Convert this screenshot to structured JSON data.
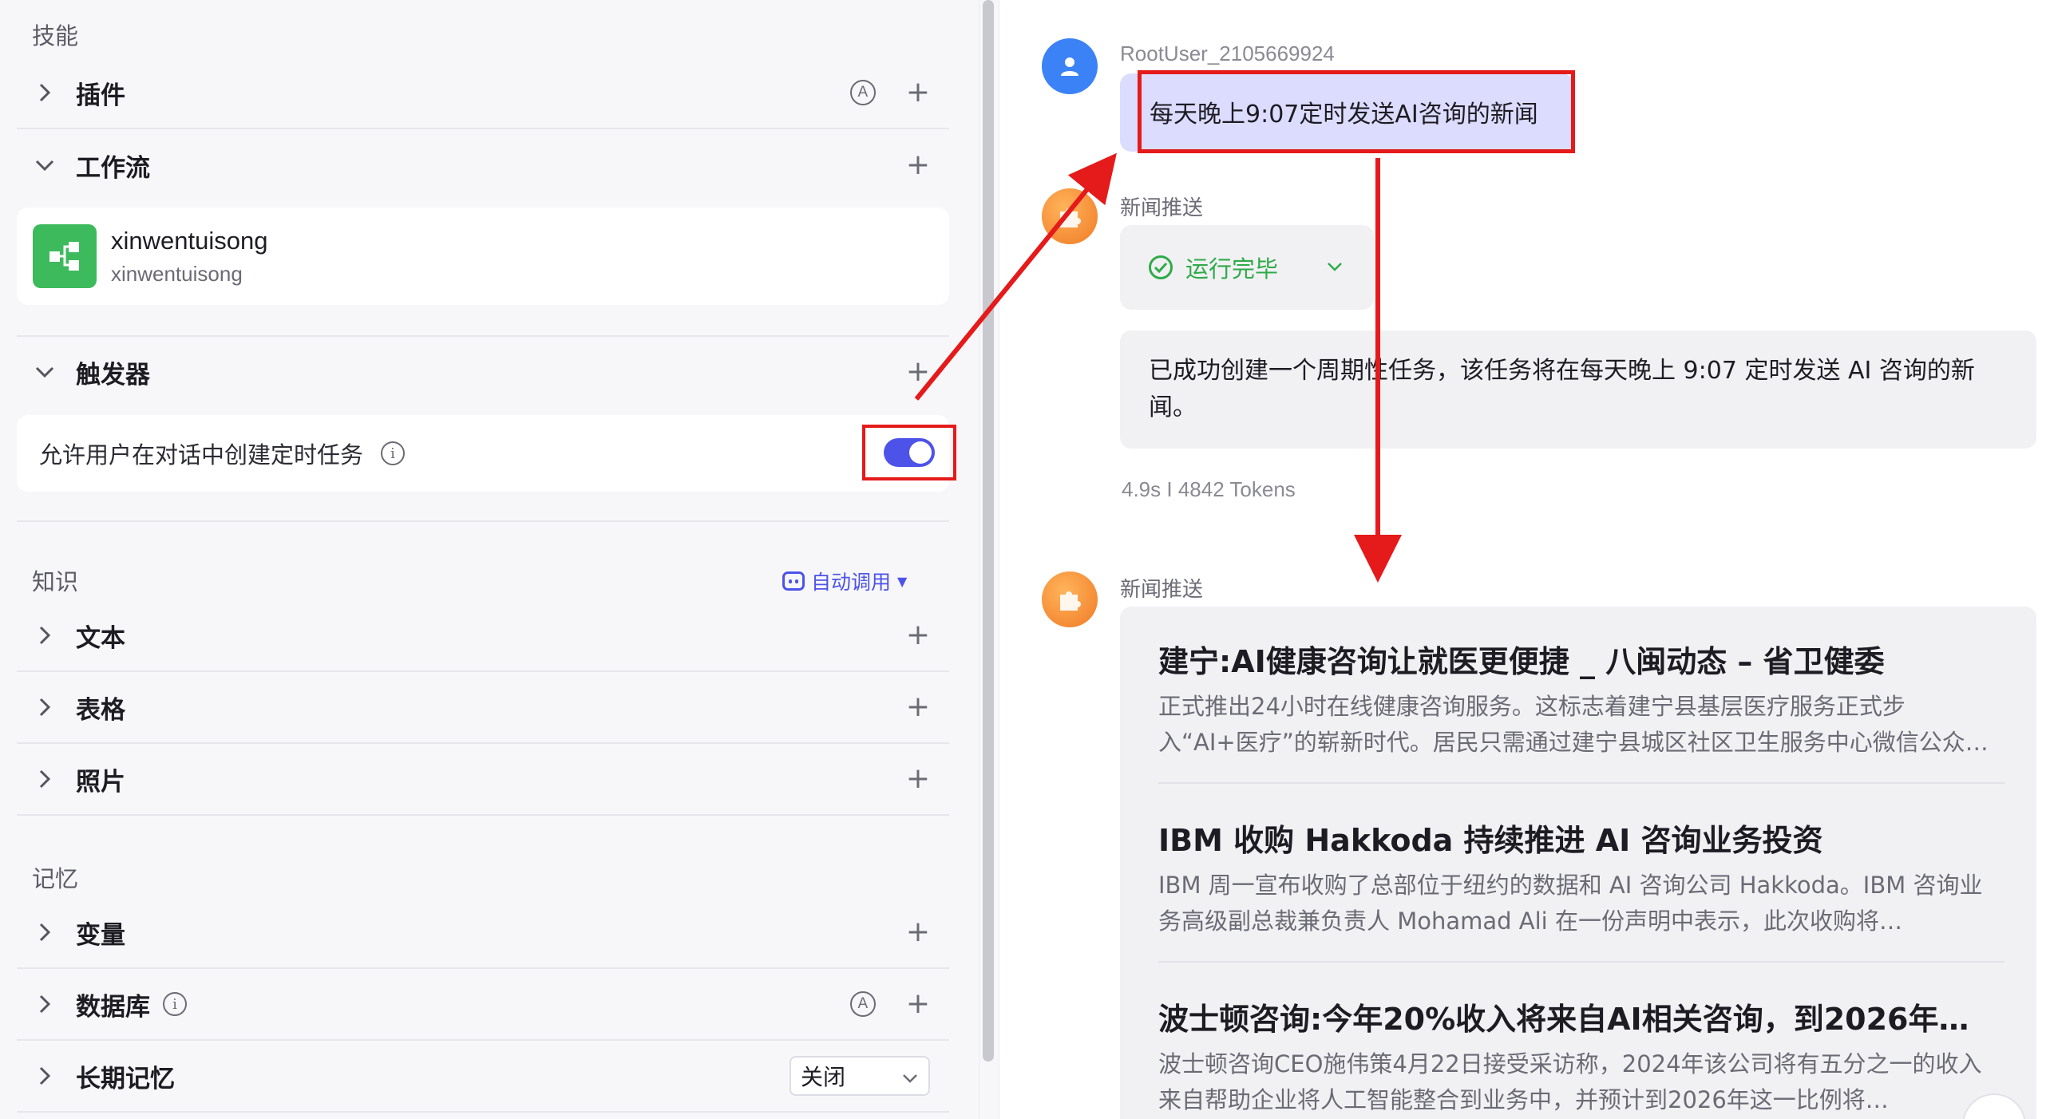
{
  "left": {
    "skills_title": "技能",
    "plugins_label": "插件",
    "workflow_label": "工作流",
    "workflow_item": {
      "name": "xinwentuisong",
      "sub": "xinwentuisong"
    },
    "trigger_label": "触发器",
    "trigger_setting": "允许用户在对话中创建定时任务",
    "toggle_on": true,
    "knowledge_title": "知识",
    "auto_call": "自动调用",
    "text_label": "文本",
    "table_label": "表格",
    "photo_label": "照片",
    "memory_title": "记忆",
    "variable_label": "变量",
    "database_label": "数据库",
    "long_memory_label": "长期记忆",
    "long_memory_value": "关闭",
    "badge_letter": "A",
    "info_letter": "i"
  },
  "chat": {
    "username": "RootUser_2105669924",
    "user_message": "每天晚上9:07定时发送AI咨询的新闻",
    "bot_name": "新闻推送",
    "status": "运行完毕",
    "reply": "已成功创建一个周期性任务，该任务将在每天晚上 9:07 定时发送 AI 咨询的新闻。",
    "meta": "4.9s  I  4842 Tokens",
    "bot_name_2": "新闻推送",
    "news": [
      {
        "title": "建宁:AI健康咨询让就医更便捷 _ 八闽动态 – 省卫健委",
        "body": "正式推出24小时在线健康咨询服务。这标志着建宁县基层医疗服务正式步入“AI+医疗”的崭新时代。居民只需通过建宁县城区社区卫生服务中心微信公众号…"
      },
      {
        "title": "IBM 收购 Hakkoda 持续推进 AI 咨询业务投资",
        "body": "IBM 周一宣布收购了总部位于纽约的数据和 AI 咨询公司 Hakkoda。IBM 咨询业务高级副总裁兼负责人 Mohamad Ali 在一份声明中表示，此次收购将…"
      },
      {
        "title": "波士顿咨询:今年20%收入将来自AI相关咨询，到2026年…",
        "body": "波士顿咨询CEO施伟策4月22日接受采访称，2024年该公司将有五分之一的收入来自帮助企业将人工智能整合到业务中，并预计到2026年这一比例将…"
      }
    ]
  },
  "colors": {
    "accent": "#4d53e8",
    "highlight_red": "#e51a1a",
    "success": "#2fab48",
    "user_bubble": "#dcdcff"
  }
}
